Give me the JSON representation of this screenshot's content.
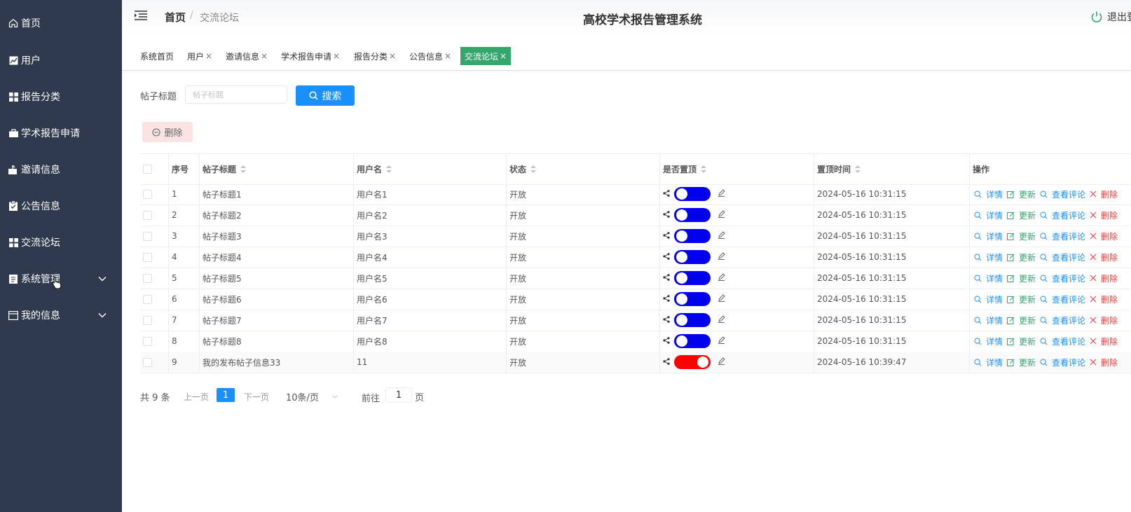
{
  "colors": {
    "sidebar_bg": "#2f3a4f",
    "accent": "#1890ff",
    "active_tab": "#36a66f",
    "switch_on": "#0000ee",
    "switch_off": "#ff0000",
    "op_blue": "#1890ff",
    "op_green": "#36a66f",
    "op_red": "#e64242"
  },
  "sidebar": {
    "items": [
      {
        "label": "首页",
        "icon": "home-icon"
      },
      {
        "label": "用户",
        "icon": "chart-icon"
      },
      {
        "label": "报告分类",
        "icon": "grid-icon"
      },
      {
        "label": "学术报告申请",
        "icon": "briefcase-icon"
      },
      {
        "label": "邀请信息",
        "icon": "inbox-icon"
      },
      {
        "label": "公告信息",
        "icon": "clipboard-icon"
      },
      {
        "label": "交流论坛",
        "icon": "grid-icon"
      },
      {
        "label": "系统管理",
        "icon": "document-icon",
        "has_submenu": true
      },
      {
        "label": "我的信息",
        "icon": "id-card-icon",
        "has_submenu": true
      }
    ]
  },
  "header": {
    "breadcrumb_home": "首页",
    "breadcrumb_sep": "/",
    "breadcrumb_current": "交流论坛",
    "title": "高校学术报告管理系统",
    "logout": "退出登录"
  },
  "tabs": [
    {
      "label": "系统首页",
      "closable": false
    },
    {
      "label": "用户",
      "closable": true
    },
    {
      "label": "邀请信息",
      "closable": true
    },
    {
      "label": "学术报告申请",
      "closable": true
    },
    {
      "label": "报告分类",
      "closable": true
    },
    {
      "label": "公告信息",
      "closable": true
    },
    {
      "label": "交流论坛",
      "closable": true,
      "active": true
    }
  ],
  "search": {
    "label": "帖子标题",
    "placeholder": "帖子标题",
    "value": "",
    "button": "搜索"
  },
  "toolbar": {
    "delete": "删除"
  },
  "table": {
    "columns": [
      "序号",
      "帖子标题",
      "用户名",
      "状态",
      "是否置顶",
      "置顶时间",
      "操作"
    ],
    "actions": [
      "详情",
      "更新",
      "查看评论",
      "删除"
    ],
    "rows": [
      {
        "no": "1",
        "title": "帖子标题1",
        "user": "用户名1",
        "status": "开放",
        "top": true,
        "time": "2024-05-16 10:31:15"
      },
      {
        "no": "2",
        "title": "帖子标题2",
        "user": "用户名2",
        "status": "开放",
        "top": true,
        "time": "2024-05-16 10:31:15"
      },
      {
        "no": "3",
        "title": "帖子标题3",
        "user": "用户名3",
        "status": "开放",
        "top": true,
        "time": "2024-05-16 10:31:15"
      },
      {
        "no": "4",
        "title": "帖子标题4",
        "user": "用户名4",
        "status": "开放",
        "top": true,
        "time": "2024-05-16 10:31:15"
      },
      {
        "no": "5",
        "title": "帖子标题5",
        "user": "用户名5",
        "status": "开放",
        "top": true,
        "time": "2024-05-16 10:31:15"
      },
      {
        "no": "6",
        "title": "帖子标题6",
        "user": "用户名6",
        "status": "开放",
        "top": true,
        "time": "2024-05-16 10:31:15"
      },
      {
        "no": "7",
        "title": "帖子标题7",
        "user": "用户名7",
        "status": "开放",
        "top": true,
        "time": "2024-05-16 10:31:15"
      },
      {
        "no": "8",
        "title": "帖子标题8",
        "user": "用户名8",
        "status": "开放",
        "top": true,
        "time": "2024-05-16 10:31:15"
      },
      {
        "no": "9",
        "title": "我的发布帖子信息33",
        "user": "11",
        "status": "开放",
        "top": false,
        "time": "2024-05-16 10:39:47"
      }
    ]
  },
  "pagination": {
    "total": "共 9 条",
    "prev": "上一页",
    "current": "1",
    "next": "下一页",
    "page_size": "10条/页",
    "goto_label": "前往",
    "goto_value": "1",
    "page_suffix": "页"
  }
}
